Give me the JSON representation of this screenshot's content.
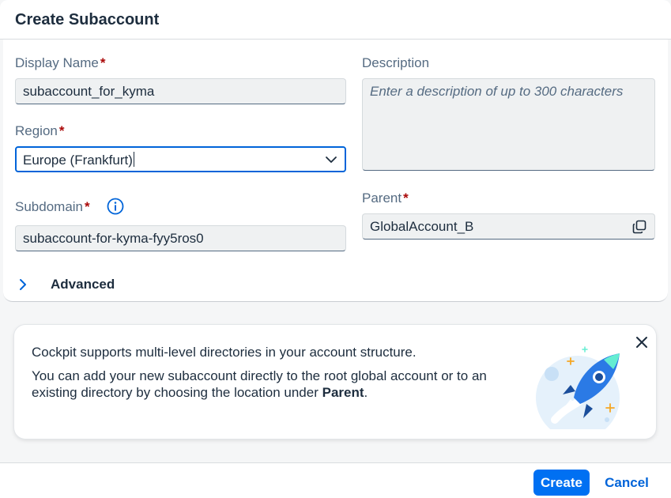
{
  "dialog": {
    "title": "Create Subaccount"
  },
  "form": {
    "display_name": {
      "label": "Display Name",
      "required_mark": "*",
      "value": "subaccount_for_kyma"
    },
    "region": {
      "label": "Region",
      "required_mark": "*",
      "value": "Europe (Frankfurt)"
    },
    "subdomain": {
      "label": "Subdomain",
      "required_mark": "*",
      "value": "subaccount-for-kyma-fyy5ros0"
    },
    "description": {
      "label": "Description",
      "placeholder": "Enter a description of up to 300 characters"
    },
    "parent": {
      "label": "Parent",
      "required_mark": "*",
      "value": "GlobalAccount_B"
    },
    "advanced_label": "Advanced"
  },
  "info_strip": {
    "line1": "Cockpit supports multi-level directories in your account structure.",
    "line2_prefix": "You can add your new subaccount directly to the root global account or to an existing directory by choosing the location under ",
    "line2_bold": "Parent",
    "line2_suffix": "."
  },
  "footer": {
    "create_label": "Create",
    "cancel_label": "Cancel"
  },
  "colors": {
    "accent": "#0064d9",
    "primary_button": "#0070f2",
    "required": "#aa0808",
    "label": "#556b82"
  },
  "icons": {
    "region_dropdown": "chevron-down-icon",
    "subdomain_info": "info-icon",
    "parent_copy": "copy-icon",
    "advanced_expand": "chevron-right-icon",
    "info_close": "close-icon",
    "illustration": "rocket-illustration"
  }
}
